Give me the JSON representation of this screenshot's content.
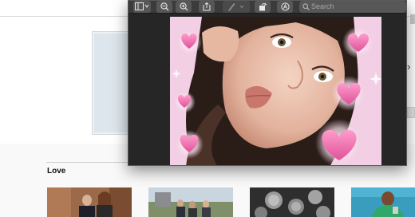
{
  "background_page": {
    "section_heading": "Love"
  },
  "preview_window": {
    "search": {
      "placeholder": "Search"
    },
    "toolbar_icons": [
      "sidebar-icon",
      "chevron-down-icon",
      "zoom-out-icon",
      "zoom-in-icon",
      "share-icon",
      "markup-pen-icon",
      "chevron-down-icon",
      "rotate-icon",
      "annotate-icon",
      "search-icon"
    ]
  },
  "colors": {
    "toolbar": "#3b3b3b",
    "toolbar_button": "#575757",
    "window_bg": "#262626",
    "heart_pink": "#f06aa8",
    "frame_pink": "#f2cfe4"
  }
}
